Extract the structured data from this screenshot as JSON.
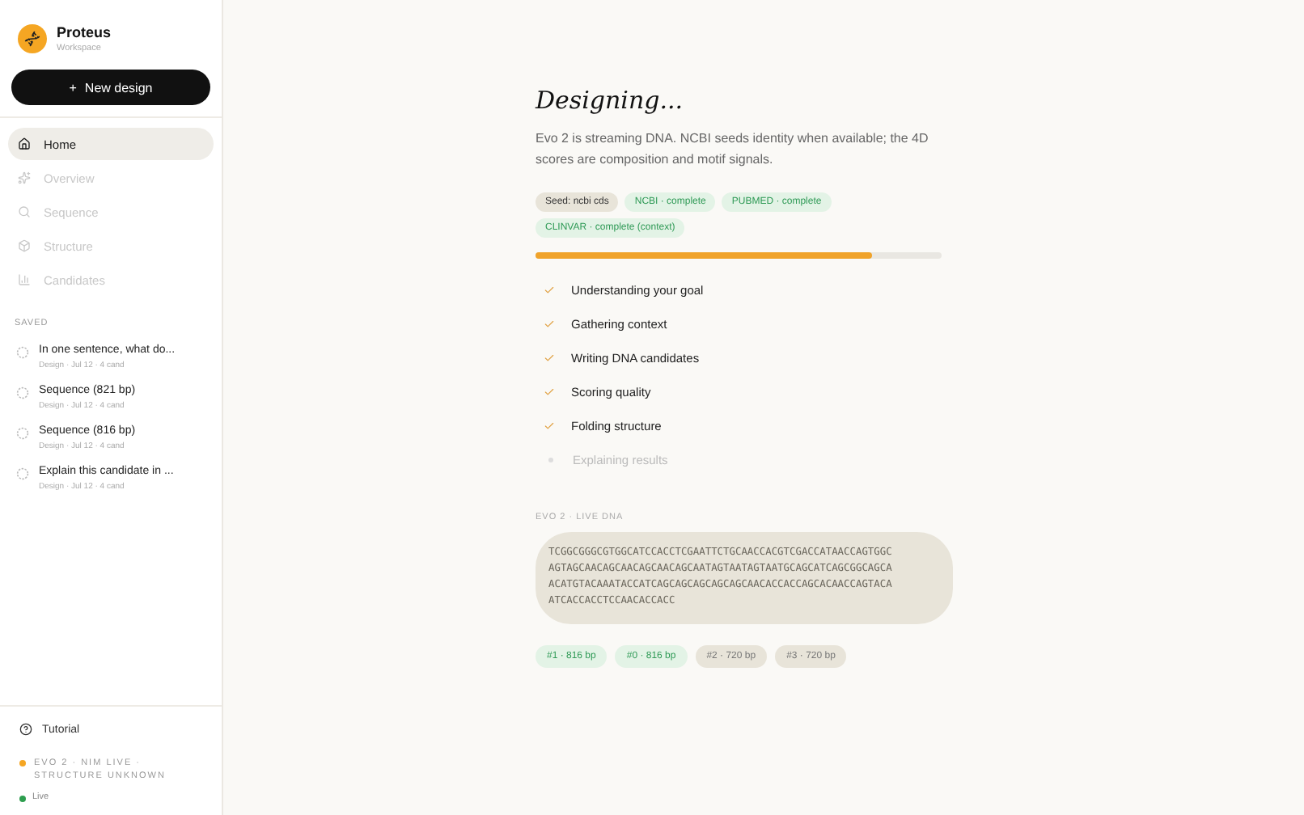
{
  "brand": {
    "name": "Proteus",
    "subtitle": "Workspace"
  },
  "new_button": {
    "icon": "+",
    "label": "New design"
  },
  "nav": [
    {
      "label": "Home",
      "selected": true,
      "disabled": false
    },
    {
      "label": "Overview",
      "selected": false,
      "disabled": true
    },
    {
      "label": "Sequence",
      "selected": false,
      "disabled": true
    },
    {
      "label": "Structure",
      "selected": false,
      "disabled": true
    },
    {
      "label": "Candidates",
      "selected": false,
      "disabled": true
    }
  ],
  "saved": {
    "heading": "SAVED",
    "items": [
      {
        "title": "In one sentence, what do...",
        "meta": "Design · Jul 12 · 4 cand"
      },
      {
        "title": "Sequence (821 bp)",
        "meta": "Design · Jul 12 · 4 cand"
      },
      {
        "title": "Sequence (816 bp)",
        "meta": "Design · Jul 12 · 4 cand"
      },
      {
        "title": "Explain this candidate in ...",
        "meta": "Design · Jul 12 · 4 cand"
      }
    ]
  },
  "footer": {
    "tutorial": "Tutorial",
    "model_status": "EVO 2 · NIM LIVE · STRUCTURE UNKNOWN",
    "live": "Live"
  },
  "main": {
    "title": "Designing...",
    "description": "Evo 2 is streaming DNA. NCBI seeds identity when available; the 4D scores are composition and motif signals.",
    "tags": [
      {
        "label": "Seed: ncbi cds",
        "kind": "seed"
      },
      {
        "label": "NCBI · complete",
        "kind": "complete"
      },
      {
        "label": "PUBMED · complete",
        "kind": "complete"
      },
      {
        "label": "CLINVAR · complete (context)",
        "kind": "complete"
      }
    ],
    "progress": {
      "level": 0.83
    },
    "steps": [
      {
        "label": "Understanding your goal",
        "done": true
      },
      {
        "label": "Gathering context",
        "done": true
      },
      {
        "label": "Writing DNA candidates",
        "done": true
      },
      {
        "label": "Scoring quality",
        "done": true
      },
      {
        "label": "Folding structure",
        "done": true
      },
      {
        "label": "Explaining results",
        "done": false
      }
    ],
    "stream": {
      "heading": "EVO 2 · LIVE DNA",
      "lines": [
        "TCGGCGGGCGTGGCATCCACCTCGAATTCTGCAACCACGTCGACCATAACCAGTGGC",
        "AGTAGCAACAGCAACAGCAACAGCAATAGTAATAGTAATGCAGCATCAGCGGCAGCA",
        "ACATGTACAAATACCATCAGCAGCAGCAGCAGCAACACCACCAGCACAACCAGTACA",
        "ATCACCACCTCCAACACCACC"
      ]
    },
    "candidates": [
      {
        "label": "#1 · 816 bp",
        "kind": "top"
      },
      {
        "label": "#0 · 816 bp",
        "kind": "top"
      },
      {
        "label": "#2 · 720 bp",
        "kind": "other"
      },
      {
        "label": "#3 · 720 bp",
        "kind": "other"
      }
    ]
  }
}
